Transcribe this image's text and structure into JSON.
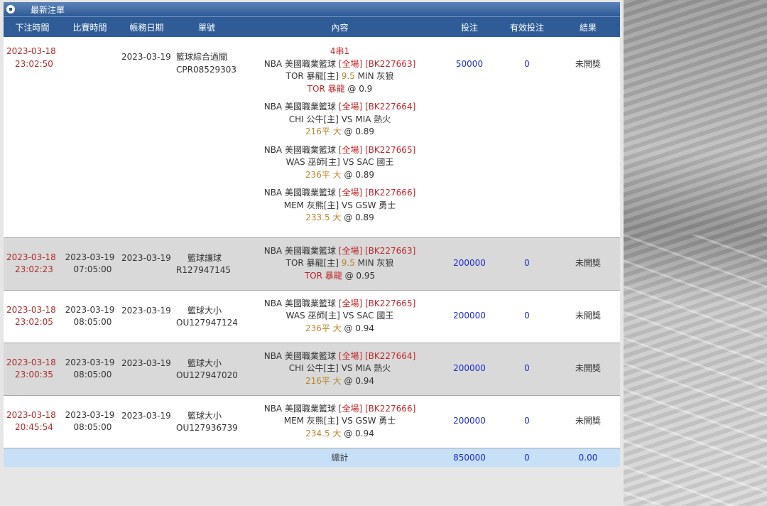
{
  "panel": {
    "title": "最新注單"
  },
  "columns": [
    "下注時間",
    "比賽時間",
    "帳務日期",
    "單號",
    "內容",
    "投注",
    "有效投注",
    "結果"
  ],
  "rows": [
    {
      "bet_date": "2023-03-18",
      "bet_time": "23:02:50",
      "match_date": "",
      "match_time": "",
      "acct_date": "2023-03-19",
      "type": "籃球綜合過關",
      "slip": "CPR08529303",
      "parlay": "4串1",
      "legs": [
        {
          "league": "NBA 美國職業籃球",
          "period": "[全場]",
          "code": "[BK227663]",
          "home": "TOR 暴龍[主]",
          "line": "9.5",
          "away": "MIN 灰狼",
          "pick": "TOR 暴龍",
          "odds": "@ 0.9"
        },
        {
          "league": "NBA 美國職業籃球",
          "period": "[全場]",
          "code": "[BK227664]",
          "home": "CHI 公牛[主]",
          "line": "VS",
          "away": "MIA 熱火",
          "pick": "216平 大",
          "odds": "@ 0.89"
        },
        {
          "league": "NBA 美國職業籃球",
          "period": "[全場]",
          "code": "[BK227665]",
          "home": "WAS 巫師[主]",
          "line": "VS",
          "away": "SAC 國王",
          "pick": "236平 大",
          "odds": "@ 0.89"
        },
        {
          "league": "NBA 美國職業籃球",
          "period": "[全場]",
          "code": "[BK227666]",
          "home": "MEM 灰熊[主]",
          "line": "VS",
          "away": "GSW 勇士",
          "pick": "233.5 大",
          "odds": "@ 0.89"
        }
      ],
      "amount": "50000",
      "effective": "0",
      "result": "未開獎"
    },
    {
      "bet_date": "2023-03-18",
      "bet_time": "23:02:23",
      "match_date": "2023-03-19",
      "match_time": "07:05:00",
      "acct_date": "2023-03-19",
      "type": "籃球讓球",
      "slip": "R127947145",
      "legs": [
        {
          "league": "NBA 美國職業籃球",
          "period": "[全場]",
          "code": "[BK227663]",
          "home": "TOR 暴龍[主]",
          "line": "9.5",
          "away": "MIN 灰狼",
          "pick": "TOR 暴龍",
          "odds": "@ 0.95"
        }
      ],
      "amount": "200000",
      "effective": "0",
      "result": "未開獎"
    },
    {
      "bet_date": "2023-03-18",
      "bet_time": "23:02:05",
      "match_date": "2023-03-19",
      "match_time": "08:05:00",
      "acct_date": "2023-03-19",
      "type": "籃球大小",
      "slip": "OU127947124",
      "legs": [
        {
          "league": "NBA 美國職業籃球",
          "period": "[全場]",
          "code": "[BK227665]",
          "home": "WAS 巫師[主]",
          "line": "VS",
          "away": "SAC 國王",
          "pick": "236平 大",
          "odds": "@ 0.94"
        }
      ],
      "amount": "200000",
      "effective": "0",
      "result": "未開獎"
    },
    {
      "bet_date": "2023-03-18",
      "bet_time": "23:00:35",
      "match_date": "2023-03-19",
      "match_time": "08:05:00",
      "acct_date": "2023-03-19",
      "type": "籃球大小",
      "slip": "OU127947020",
      "legs": [
        {
          "league": "NBA 美國職業籃球",
          "period": "[全場]",
          "code": "[BK227664]",
          "home": "CHI 公牛[主]",
          "line": "VS",
          "away": "MIA 熱火",
          "pick": "216平 大",
          "odds": "@ 0.94"
        }
      ],
      "amount": "200000",
      "effective": "0",
      "result": "未開獎"
    },
    {
      "bet_date": "2023-03-18",
      "bet_time": "20:45:54",
      "match_date": "2023-03-19",
      "match_time": "08:05:00",
      "acct_date": "2023-03-19",
      "type": "籃球大小",
      "slip": "OU127936739",
      "legs": [
        {
          "league": "NBA 美國職業籃球",
          "period": "[全場]",
          "code": "[BK227666]",
          "home": "MEM 灰熊[主]",
          "line": "VS",
          "away": "GSW 勇士",
          "pick": "234.5 大",
          "odds": "@ 0.94"
        }
      ],
      "amount": "200000",
      "effective": "0",
      "result": "未開獎"
    }
  ],
  "totals": {
    "label": "總計",
    "amount": "850000",
    "effective": "0",
    "result": "0.00"
  },
  "colors": {
    "header": "#2f5c97",
    "red": "#c0262b",
    "olive": "#b8862e",
    "blue": "#1e2bd2",
    "total_bg": "#c7e0f7"
  }
}
